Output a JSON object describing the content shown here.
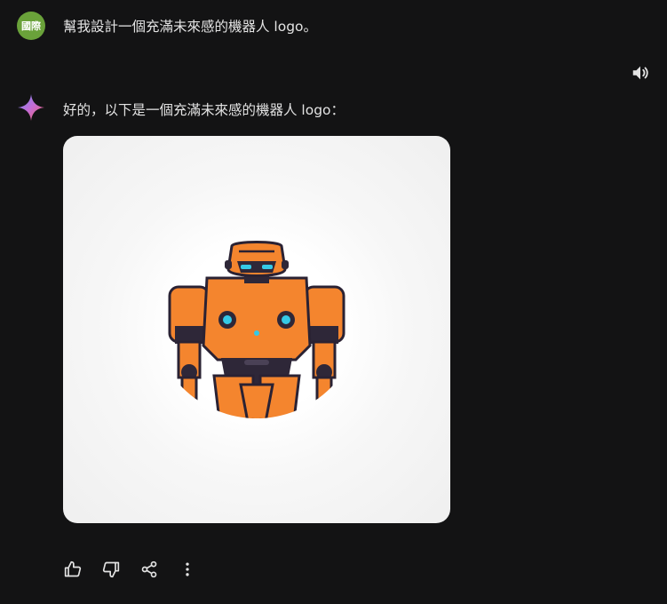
{
  "user": {
    "avatar_text": "國際",
    "avatar_color": "#6aa23a",
    "message": "幫我設計一個充滿未來感的機器人 logo。"
  },
  "assistant": {
    "logo_icon": "sparkle-icon",
    "reply": "好的，以下是一個充滿未來感的機器人 logo："
  },
  "generated_image": {
    "subject": "orange-robot",
    "accent_color": "#f4852e",
    "eye_color": "#35c9e6"
  },
  "actions": {
    "icons": [
      "thumbs-up-icon",
      "thumbs-down-icon",
      "share-icon",
      "more-vert-icon"
    ]
  },
  "speaker_icon": "speaker-icon"
}
